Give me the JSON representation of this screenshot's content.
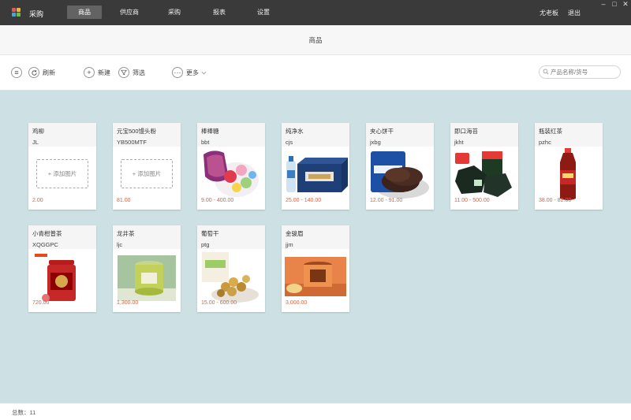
{
  "app": {
    "title": "采购"
  },
  "nav": [
    {
      "label": "商品",
      "active": true
    },
    {
      "label": "供应商",
      "active": false
    },
    {
      "label": "采购",
      "active": false
    },
    {
      "label": "报表",
      "active": false
    },
    {
      "label": "设置",
      "active": false
    }
  ],
  "user": {
    "name": "尤老板",
    "logout": "退出"
  },
  "window_controls": {
    "minimize": "–",
    "maximize": "□",
    "close": "✕"
  },
  "page": {
    "title": "商品"
  },
  "toolbar": {
    "menu_icon": "≡",
    "refresh": "刷新",
    "new": "新建",
    "filter": "筛选",
    "more": "更多",
    "search_placeholder": "产品名称/货号"
  },
  "products": [
    {
      "name": "鸡柳",
      "code": "JL",
      "price": "2.00",
      "image": "placeholder",
      "add_label": "+ 添加图片"
    },
    {
      "name": "元宝500馒头粉",
      "code": "YB500MTF",
      "price": "81.00",
      "image": "placeholder",
      "add_label": "+ 添加图片"
    },
    {
      "name": "棒棒糖",
      "code": "bbt",
      "price": "9.00 - 400.00",
      "image": "lollipop-photo"
    },
    {
      "name": "纯净水",
      "code": "cjs",
      "price": "25.00 - 140.00",
      "image": "water-photo"
    },
    {
      "name": "夹心饼干",
      "code": "jxbg",
      "price": "12.00 - 91.00",
      "image": "cookie-photo"
    },
    {
      "name": "即口海苔",
      "code": "jkht",
      "price": "11.00 - 500.00",
      "image": "seaweed-photo"
    },
    {
      "name": "瓶装红茶",
      "code": "pzhc",
      "price": "38.00 - 82.00",
      "image": "tea-bottle-photo"
    },
    {
      "name": "小青柑普茶",
      "code": "XQGGPC",
      "price": "720.00",
      "image": "tea-can-photo"
    },
    {
      "name": "龙井茶",
      "code": "ljc",
      "price": "1,300.00",
      "image": "green-tea-can-photo"
    },
    {
      "name": "葡萄干",
      "code": "ptg",
      "price": "15.00 - 600.00",
      "image": "raisin-photo"
    },
    {
      "name": "金骏眉",
      "code": "jjm",
      "price": "3,000.00",
      "image": "black-tea-photo"
    }
  ],
  "footer": {
    "total": "总数：11"
  },
  "colors": {
    "topbar": "#3a3a3a",
    "accent_price": "#e0623c",
    "background": "#cde0e3"
  }
}
